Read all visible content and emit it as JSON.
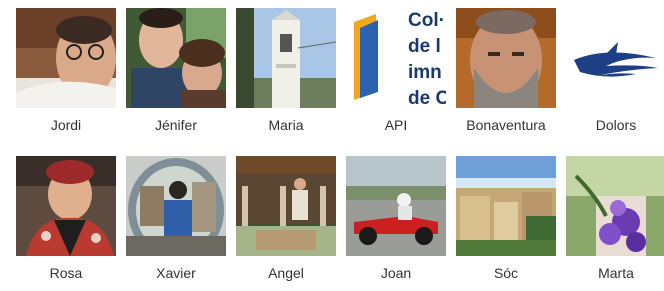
{
  "contacts": [
    {
      "name": "Jordi",
      "icon": "photo-man-glasses"
    },
    {
      "name": "Jénifer",
      "icon": "photo-couple"
    },
    {
      "name": "Maria",
      "icon": "photo-bell-tower"
    },
    {
      "name": "API",
      "icon": "logo-col-legi"
    },
    {
      "name": "Bonaventura",
      "icon": "photo-bearded-man"
    },
    {
      "name": "Dolors",
      "icon": "logo-bird"
    },
    {
      "name": "Rosa",
      "icon": "photo-woman"
    },
    {
      "name": "Xavier",
      "icon": "photo-mirror-selfie"
    },
    {
      "name": "Angel",
      "icon": "photo-porch"
    },
    {
      "name": "Joan",
      "icon": "photo-go-kart"
    },
    {
      "name": "Sóc",
      "icon": "photo-town"
    },
    {
      "name": "Marta",
      "icon": "photo-flowers"
    }
  ],
  "api_logo": {
    "lines": [
      "Col·",
      "de l",
      "imn",
      "de C"
    ]
  }
}
